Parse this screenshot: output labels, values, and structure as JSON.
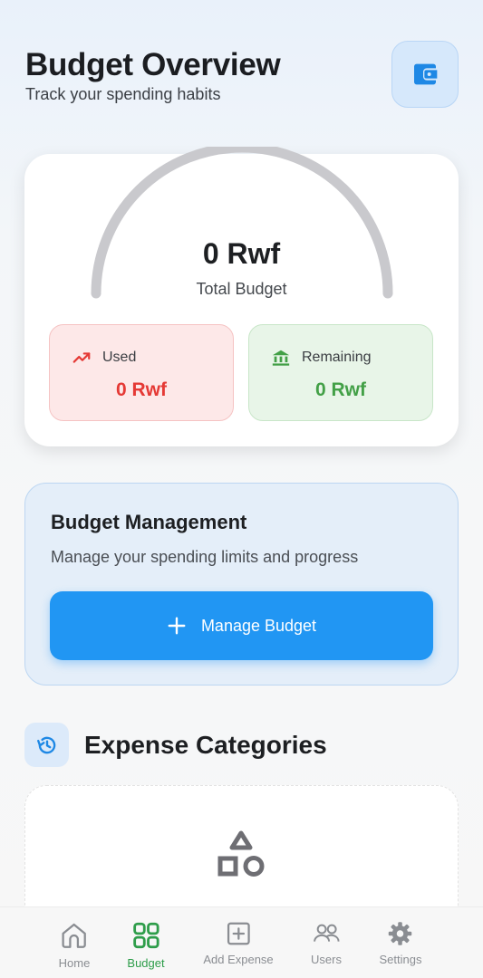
{
  "header": {
    "title": "Budget Overview",
    "subtitle": "Track your spending habits",
    "wallet_icon": "wallet-icon"
  },
  "summary": {
    "total_amount": "0 Rwf",
    "total_label": "Total Budget",
    "gauge_fraction_used": 0,
    "used": {
      "label": "Used",
      "value": "0 Rwf",
      "icon": "trending-up-icon",
      "color": "#e53935"
    },
    "remaining": {
      "label": "Remaining",
      "value": "0 Rwf",
      "icon": "bank-icon",
      "color": "#43a047"
    }
  },
  "management": {
    "title": "Budget Management",
    "description": "Manage your spending limits and progress",
    "button_label": "Manage Budget"
  },
  "categories": {
    "title": "Expense Categories",
    "icon": "history-icon",
    "empty_icon": "shapes-icon"
  },
  "nav": {
    "items": [
      {
        "label": "Home",
        "icon": "home-icon",
        "active": false
      },
      {
        "label": "Budget",
        "icon": "grid-icon",
        "active": true
      },
      {
        "label": "Add Expense",
        "icon": "add-box-icon",
        "active": false
      },
      {
        "label": "Users",
        "icon": "users-icon",
        "active": false
      },
      {
        "label": "Settings",
        "icon": "gear-icon",
        "active": false
      }
    ]
  },
  "colors": {
    "accent": "#2196f3",
    "active_nav": "#2e9d4a",
    "gauge_track": "#c9c9cd"
  }
}
